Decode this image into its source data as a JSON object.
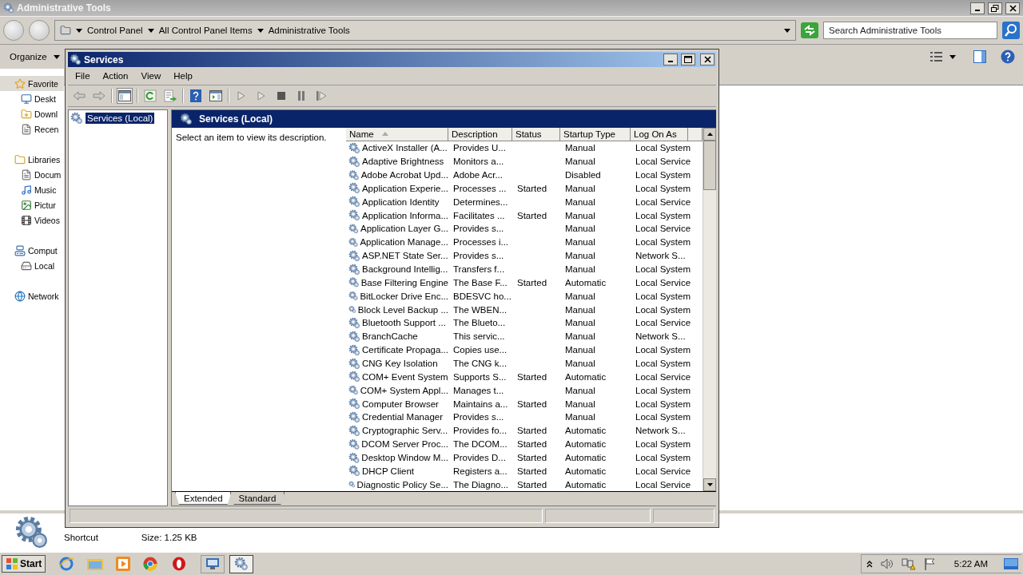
{
  "explorer": {
    "title": "Administrative Tools",
    "breadcrumb": [
      "Control Panel",
      "All Control Panel Items",
      "Administrative Tools"
    ],
    "search": {
      "placeholder": "Search Administrative Tools"
    },
    "organize": "Organize",
    "nav": [
      {
        "label": "Favorite",
        "selected": true,
        "children": [
          {
            "label": "Deskt",
            "selected": false
          },
          {
            "label": "Downl",
            "selected": false
          },
          {
            "label": "Recen",
            "selected": false
          }
        ]
      },
      {
        "label": "Libraries",
        "selected": false,
        "children": [
          {
            "label": "Docum",
            "selected": false
          },
          {
            "label": "Music",
            "selected": false
          },
          {
            "label": "Pictur",
            "selected": false
          },
          {
            "label": "Videos",
            "selected": false
          }
        ]
      },
      {
        "label": "Comput",
        "selected": false,
        "children": [
          {
            "label": "Local",
            "selected": false
          }
        ]
      },
      {
        "label": "Network",
        "selected": false
      }
    ],
    "details": {
      "type": "Shortcut",
      "size": "Size: 1.25 KB"
    }
  },
  "services": {
    "title": "Services",
    "menu": [
      "File",
      "Action",
      "View",
      "Help"
    ],
    "tree": [
      {
        "label": "Services (Local)",
        "selected": true
      }
    ],
    "header": "Services (Local)",
    "description": "Select an item to view its description.",
    "columns": [
      {
        "label": "Name",
        "sorted": true
      },
      {
        "label": "Description",
        "sorted": false
      },
      {
        "label": "Status",
        "sorted": false
      },
      {
        "label": "Startup Type",
        "sorted": false
      },
      {
        "label": "Log On As",
        "sorted": false
      }
    ],
    "rows": [
      {
        "name": "ActiveX Installer (A...",
        "description": "Provides U...",
        "startup_type": "Manual",
        "log_on_as": "Local System"
      },
      {
        "name": "Adaptive Brightness",
        "description": "Monitors a...",
        "startup_type": "Manual",
        "log_on_as": "Local Service"
      },
      {
        "name": "Adobe Acrobat Upd...",
        "description": "Adobe Acr...",
        "startup_type": "Disabled",
        "log_on_as": "Local System"
      },
      {
        "name": "Application Experie...",
        "description": "Processes ...",
        "status": "Started",
        "startup_type": "Manual",
        "log_on_as": "Local System"
      },
      {
        "name": "Application Identity",
        "description": "Determines...",
        "startup_type": "Manual",
        "log_on_as": "Local Service"
      },
      {
        "name": "Application Informa...",
        "description": "Facilitates ...",
        "status": "Started",
        "startup_type": "Manual",
        "log_on_as": "Local System"
      },
      {
        "name": "Application Layer G...",
        "description": "Provides s...",
        "startup_type": "Manual",
        "log_on_as": "Local Service"
      },
      {
        "name": "Application Manage...",
        "description": "Processes i...",
        "startup_type": "Manual",
        "log_on_as": "Local System"
      },
      {
        "name": "ASP.NET State Ser...",
        "description": "Provides s...",
        "startup_type": "Manual",
        "log_on_as": "Network S..."
      },
      {
        "name": "Background Intellig...",
        "description": "Transfers f...",
        "startup_type": "Manual",
        "log_on_as": "Local System"
      },
      {
        "name": "Base Filtering Engine",
        "description": "The Base F...",
        "status": "Started",
        "startup_type": "Automatic",
        "log_on_as": "Local Service"
      },
      {
        "name": "BitLocker Drive Enc...",
        "description": "BDESVC ho...",
        "startup_type": "Manual",
        "log_on_as": "Local System"
      },
      {
        "name": "Block Level Backup ...",
        "description": "The WBEN...",
        "startup_type": "Manual",
        "log_on_as": "Local System"
      },
      {
        "name": "Bluetooth Support ...",
        "description": "The Blueto...",
        "startup_type": "Manual",
        "log_on_as": "Local Service"
      },
      {
        "name": "BranchCache",
        "description": "This servic...",
        "startup_type": "Manual",
        "log_on_as": "Network S..."
      },
      {
        "name": "Certificate Propaga...",
        "description": "Copies use...",
        "startup_type": "Manual",
        "log_on_as": "Local System"
      },
      {
        "name": "CNG Key Isolation",
        "description": "The CNG k...",
        "startup_type": "Manual",
        "log_on_as": "Local System"
      },
      {
        "name": "COM+ Event System",
        "description": "Supports S...",
        "status": "Started",
        "startup_type": "Automatic",
        "log_on_as": "Local Service"
      },
      {
        "name": "COM+ System Appl...",
        "description": "Manages t...",
        "startup_type": "Manual",
        "log_on_as": "Local System"
      },
      {
        "name": "Computer Browser",
        "description": "Maintains a...",
        "status": "Started",
        "startup_type": "Manual",
        "log_on_as": "Local System"
      },
      {
        "name": "Credential Manager",
        "description": "Provides s...",
        "startup_type": "Manual",
        "log_on_as": "Local System"
      },
      {
        "name": "Cryptographic Serv...",
        "description": "Provides fo...",
        "status": "Started",
        "startup_type": "Automatic",
        "log_on_as": "Network S..."
      },
      {
        "name": "DCOM Server Proc...",
        "description": "The DCOM...",
        "status": "Started",
        "startup_type": "Automatic",
        "log_on_as": "Local System"
      },
      {
        "name": "Desktop Window M...",
        "description": "Provides D...",
        "status": "Started",
        "startup_type": "Automatic",
        "log_on_as": "Local System"
      },
      {
        "name": "DHCP Client",
        "description": "Registers a...",
        "status": "Started",
        "startup_type": "Automatic",
        "log_on_as": "Local Service"
      },
      {
        "name": "Diagnostic Policy Se...",
        "description": "The Diagno...",
        "status": "Started",
        "startup_type": "Automatic",
        "log_on_as": "Local Service"
      }
    ],
    "tabs": [
      {
        "label": "Extended",
        "selected": true
      },
      {
        "label": "Standard",
        "selected": false
      }
    ]
  },
  "taskbar": {
    "start": "Start",
    "clock": "5:22 AM"
  }
}
